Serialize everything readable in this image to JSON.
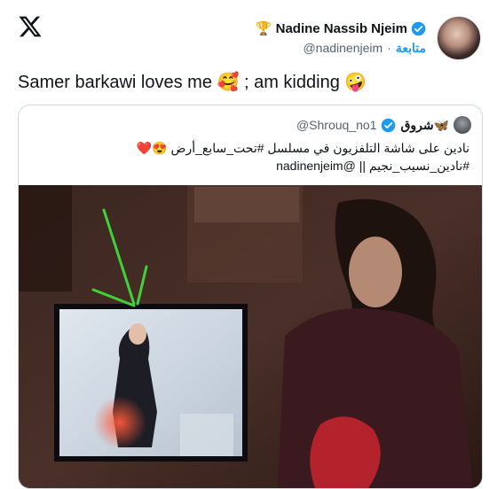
{
  "app": {
    "logo_icon": "x-logo-icon"
  },
  "author": {
    "display_name": "Nadine Nassib Njeim",
    "badge_emoji": "🏆",
    "follow_label": "متابعة",
    "separator": "·",
    "handle": "@nadinenjeim"
  },
  "tweet": {
    "text": "Samer barkawi loves me 🥰 ; am kidding 🤪"
  },
  "quote": {
    "name": "شروق🦋",
    "handle": "@Shrouq_no1",
    "line1": "نادين على شاشة التلفزيون في مسلسل #تحت_سابع_أرض 😍❤️",
    "line2": "#نادين_نسيب_نجيم || @nadinenjeim"
  },
  "colors": {
    "accent": "#1d9bf0",
    "text_primary": "#0f1419",
    "text_secondary": "#536471",
    "border": "#cfd9de",
    "annotation_arrows": "#3fd13a"
  }
}
